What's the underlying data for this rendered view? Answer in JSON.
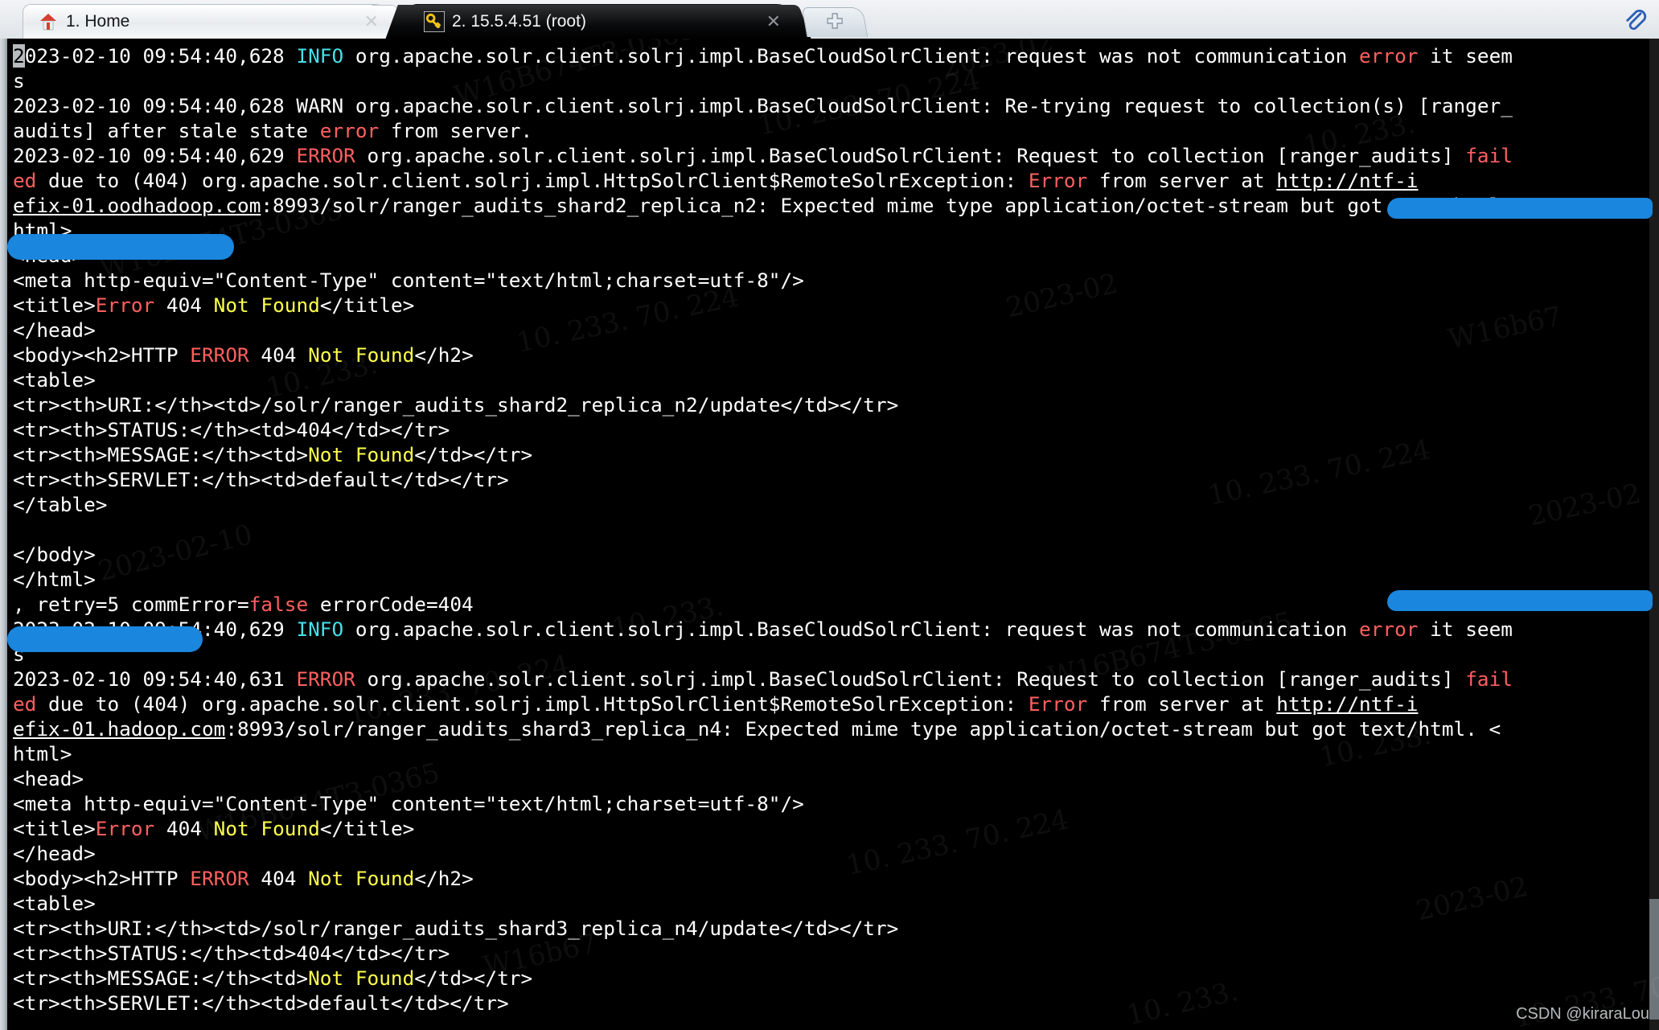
{
  "window": {
    "tabs": [
      {
        "index": "1",
        "label": "1. Home",
        "icon": "home-icon",
        "close": "✕",
        "active": false
      },
      {
        "index": "2",
        "label": "2. 15.5.4.51 (root)",
        "icon": "key-icon",
        "close": "✕",
        "active": true
      }
    ],
    "new_tab_label": "+",
    "clip_icon": "paperclip-icon"
  },
  "watermark": {
    "credit": "CSDN @kiraraLou",
    "faint": [
      "W16B674T3-0365",
      "2023-02",
      "10. 233. 70. 224",
      "10. 233.",
      "W16B674T3-0365",
      "10. 233. 70. 224",
      "2023-02",
      "W16b67",
      "10. 233.",
      "10. 233. 70. 224",
      "2023-02-10",
      "10. 233."
    ]
  },
  "terminal": {
    "cursor_char": "2",
    "lines": [
      {
        "id": "l1",
        "segs": [
          {
            "t": "2",
            "c": "cursor"
          },
          {
            "t": "023-02-10 09:54:40,628 ",
            "c": ""
          },
          {
            "t": "INFO",
            "c": "cyan"
          },
          {
            "t": " org.apache.solr.client.solrj.impl.BaseCloudSolrClient: request was not communication ",
            "c": ""
          },
          {
            "t": "error",
            "c": "red"
          },
          {
            "t": " it seem",
            "c": ""
          }
        ]
      },
      {
        "id": "l2",
        "segs": [
          {
            "t": "s",
            "c": ""
          }
        ]
      },
      {
        "id": "l3",
        "segs": [
          {
            "t": "2023-02-10 09:54:40,628 WARN org.apache.solr.client.solrj.impl.BaseCloudSolrClient: Re-trying request to collection(s) [ranger_",
            "c": ""
          }
        ]
      },
      {
        "id": "l4",
        "segs": [
          {
            "t": "audits] after stale state ",
            "c": ""
          },
          {
            "t": "error",
            "c": "red"
          },
          {
            "t": " from server.",
            "c": ""
          }
        ]
      },
      {
        "id": "l5",
        "segs": [
          {
            "t": "2023-02-10 09:54:40,629 ",
            "c": ""
          },
          {
            "t": "ERROR",
            "c": "red"
          },
          {
            "t": " org.apache.solr.client.solrj.impl.BaseCloudSolrClient: Request to collection [ranger_audits] ",
            "c": ""
          },
          {
            "t": "fail",
            "c": "red"
          }
        ]
      },
      {
        "id": "l6",
        "segs": [
          {
            "t": "ed",
            "c": "red"
          },
          {
            "t": " due to (404) org.apache.solr.client.solrj.impl.HttpSolrClient$RemoteSolrException: ",
            "c": ""
          },
          {
            "t": "Error",
            "c": "red"
          },
          {
            "t": " from server at ",
            "c": ""
          },
          {
            "t": "http://ntf-i",
            "c": "link"
          }
        ]
      },
      {
        "id": "l7",
        "segs": [
          {
            "t": "efix-01.oodhadoop.com",
            "c": "link"
          },
          {
            "t": ":8993/solr/ranger_audits_shard2_replica_n2: Expected mime type application/octet-stream but got text/html. <",
            "c": ""
          }
        ]
      },
      {
        "id": "l8",
        "segs": [
          {
            "t": "html>",
            "c": ""
          }
        ]
      },
      {
        "id": "l9",
        "segs": [
          {
            "t": "<head>",
            "c": ""
          }
        ]
      },
      {
        "id": "l10",
        "segs": [
          {
            "t": "<meta http-equiv=\"Content-Type\" content=\"text/html;charset=utf-8\"/>",
            "c": ""
          }
        ]
      },
      {
        "id": "l11",
        "segs": [
          {
            "t": "<title>",
            "c": ""
          },
          {
            "t": "Error",
            "c": "red"
          },
          {
            "t": " 404 ",
            "c": ""
          },
          {
            "t": "Not Found",
            "c": "yellow"
          },
          {
            "t": "</title>",
            "c": ""
          }
        ]
      },
      {
        "id": "l12",
        "segs": [
          {
            "t": "</head>",
            "c": ""
          }
        ]
      },
      {
        "id": "l13",
        "segs": [
          {
            "t": "<body><h2>HTTP ",
            "c": ""
          },
          {
            "t": "ERROR",
            "c": "red"
          },
          {
            "t": " 404 ",
            "c": ""
          },
          {
            "t": "Not Found",
            "c": "yellow"
          },
          {
            "t": "</h2>",
            "c": ""
          }
        ]
      },
      {
        "id": "l14",
        "segs": [
          {
            "t": "<table>",
            "c": ""
          }
        ]
      },
      {
        "id": "l15",
        "segs": [
          {
            "t": "<tr><th>URI:</th><td>/solr/ranger_audits_shard2_replica_n2/update</td></tr>",
            "c": ""
          }
        ]
      },
      {
        "id": "l16",
        "segs": [
          {
            "t": "<tr><th>STATUS:</th><td>404</td></tr>",
            "c": ""
          }
        ]
      },
      {
        "id": "l17",
        "segs": [
          {
            "t": "<tr><th>MESSAGE:</th><td>",
            "c": ""
          },
          {
            "t": "Not Found",
            "c": "yellow"
          },
          {
            "t": "</td></tr>",
            "c": ""
          }
        ]
      },
      {
        "id": "l18",
        "segs": [
          {
            "t": "<tr><th>SERVLET:</th><td>default</td></tr>",
            "c": ""
          }
        ]
      },
      {
        "id": "l19",
        "segs": [
          {
            "t": "</table>",
            "c": ""
          }
        ]
      },
      {
        "id": "l20",
        "segs": [
          {
            "t": "",
            "c": ""
          }
        ]
      },
      {
        "id": "l21",
        "segs": [
          {
            "t": "</body>",
            "c": ""
          }
        ]
      },
      {
        "id": "l22",
        "segs": [
          {
            "t": "</html>",
            "c": ""
          }
        ]
      },
      {
        "id": "l23",
        "segs": [
          {
            "t": ", retry=5 commError=",
            "c": ""
          },
          {
            "t": "false",
            "c": "red"
          },
          {
            "t": " errorCode=404",
            "c": ""
          }
        ]
      },
      {
        "id": "l24",
        "segs": [
          {
            "t": "2023-02-10 09:54:40,629 ",
            "c": ""
          },
          {
            "t": "INFO",
            "c": "cyan"
          },
          {
            "t": " org.apache.solr.client.solrj.impl.BaseCloudSolrClient: request was not communication ",
            "c": ""
          },
          {
            "t": "error",
            "c": "red"
          },
          {
            "t": " it seem",
            "c": ""
          }
        ]
      },
      {
        "id": "l25",
        "segs": [
          {
            "t": "s",
            "c": ""
          }
        ]
      },
      {
        "id": "l26",
        "segs": [
          {
            "t": "2023-02-10 09:54:40,631 ",
            "c": ""
          },
          {
            "t": "ERROR",
            "c": "red"
          },
          {
            "t": " org.apache.solr.client.solrj.impl.BaseCloudSolrClient: Request to collection [ranger_audits] ",
            "c": ""
          },
          {
            "t": "fail",
            "c": "red"
          }
        ]
      },
      {
        "id": "l27",
        "segs": [
          {
            "t": "ed",
            "c": "red"
          },
          {
            "t": " due to (404) org.apache.solr.client.solrj.impl.HttpSolrClient$RemoteSolrException: ",
            "c": ""
          },
          {
            "t": "Error",
            "c": "red"
          },
          {
            "t": " from server at ",
            "c": ""
          },
          {
            "t": "http://ntf-i",
            "c": "link"
          }
        ]
      },
      {
        "id": "l28",
        "segs": [
          {
            "t": "efix-01.hadoop.com",
            "c": "link"
          },
          {
            "t": ":8993/solr/ranger_audits_shard3_replica_n4: Expected mime type application/octet-stream but got text/html. <",
            "c": ""
          }
        ]
      },
      {
        "id": "l29",
        "segs": [
          {
            "t": "html>",
            "c": ""
          }
        ]
      },
      {
        "id": "l30",
        "segs": [
          {
            "t": "<head>",
            "c": ""
          }
        ]
      },
      {
        "id": "l31",
        "segs": [
          {
            "t": "<meta http-equiv=\"Content-Type\" content=\"text/html;charset=utf-8\"/>",
            "c": ""
          }
        ]
      },
      {
        "id": "l32",
        "segs": [
          {
            "t": "<title>",
            "c": ""
          },
          {
            "t": "Error",
            "c": "red"
          },
          {
            "t": " 404 ",
            "c": ""
          },
          {
            "t": "Not Found",
            "c": "yellow"
          },
          {
            "t": "</title>",
            "c": ""
          }
        ]
      },
      {
        "id": "l33",
        "segs": [
          {
            "t": "</head>",
            "c": ""
          }
        ]
      },
      {
        "id": "l34",
        "segs": [
          {
            "t": "<body><h2>HTTP ",
            "c": ""
          },
          {
            "t": "ERROR",
            "c": "red"
          },
          {
            "t": " 404 ",
            "c": ""
          },
          {
            "t": "Not Found",
            "c": "yellow"
          },
          {
            "t": "</h2>",
            "c": ""
          }
        ]
      },
      {
        "id": "l35",
        "segs": [
          {
            "t": "<table>",
            "c": ""
          }
        ]
      },
      {
        "id": "l36",
        "segs": [
          {
            "t": "<tr><th>URI:</th><td>/solr/ranger_audits_shard3_replica_n4/update</td></tr>",
            "c": ""
          }
        ]
      },
      {
        "id": "l37",
        "segs": [
          {
            "t": "<tr><th>STATUS:</th><td>404</td></tr>",
            "c": ""
          }
        ]
      },
      {
        "id": "l38",
        "segs": [
          {
            "t": "<tr><th>MESSAGE:</th><td>",
            "c": ""
          },
          {
            "t": "Not Found",
            "c": "yellow"
          },
          {
            "t": "</td></tr>",
            "c": ""
          }
        ]
      },
      {
        "id": "l39",
        "segs": [
          {
            "t": "<tr><th>SERVLET:</th><td>default</td></tr>",
            "c": ""
          }
        ]
      }
    ]
  },
  "colors": {
    "background": "#000000",
    "foreground": "#ffffff",
    "red": "#ff5f5f",
    "cyan": "#45e0e8",
    "yellow": "#ffff4d",
    "redaction": "#1a86dd"
  }
}
